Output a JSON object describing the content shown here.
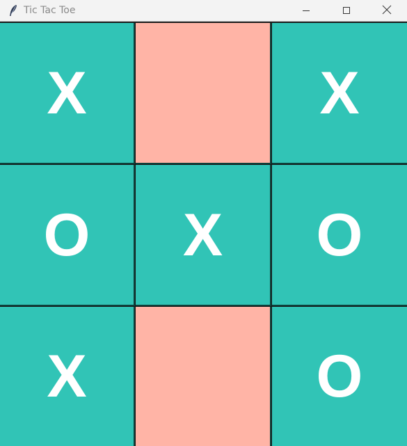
{
  "window": {
    "title": "Tic Tac Toe",
    "icons": {
      "app": "feather-icon",
      "minimize": "minimize-icon",
      "maximize": "maximize-icon",
      "close": "close-icon"
    }
  },
  "board": {
    "colors": {
      "filled": "#31c4b6",
      "empty": "#ffb4a6",
      "mark": "#ffffff",
      "gridline": "#0e3f39"
    },
    "cells": [
      {
        "row": 0,
        "col": 0,
        "mark": "X"
      },
      {
        "row": 0,
        "col": 1,
        "mark": ""
      },
      {
        "row": 0,
        "col": 2,
        "mark": "X"
      },
      {
        "row": 1,
        "col": 0,
        "mark": "O"
      },
      {
        "row": 1,
        "col": 1,
        "mark": "X"
      },
      {
        "row": 1,
        "col": 2,
        "mark": "O"
      },
      {
        "row": 2,
        "col": 0,
        "mark": "X"
      },
      {
        "row": 2,
        "col": 1,
        "mark": ""
      },
      {
        "row": 2,
        "col": 2,
        "mark": "O"
      }
    ]
  }
}
